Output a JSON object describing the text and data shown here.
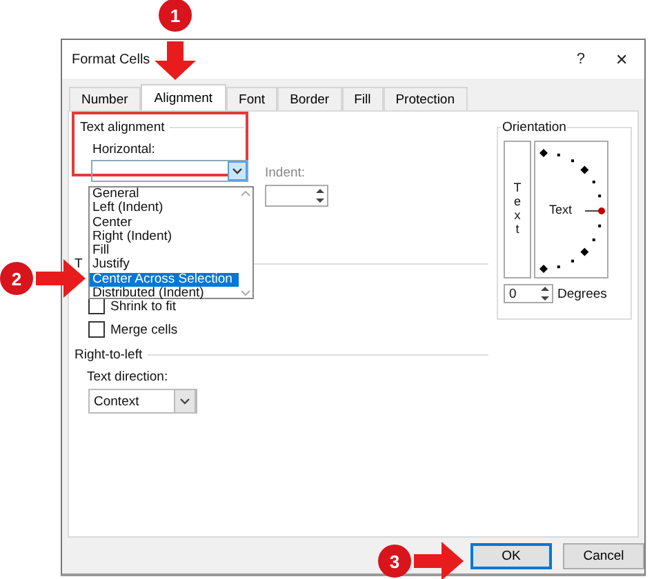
{
  "window": {
    "title": "Format Cells",
    "help": "?",
    "close": "✕"
  },
  "tabs": [
    {
      "label": "Number",
      "selected": false
    },
    {
      "label": "Alignment",
      "selected": true
    },
    {
      "label": "Font",
      "selected": false
    },
    {
      "label": "Border",
      "selected": false
    },
    {
      "label": "Fill",
      "selected": false
    },
    {
      "label": "Protection",
      "selected": false
    }
  ],
  "text_alignment": {
    "heading": "Text alignment",
    "horizontal_label": "Horizontal:",
    "indent_label": "Indent:",
    "options": [
      {
        "label": "General",
        "selected": false
      },
      {
        "label": "Left (Indent)",
        "selected": false
      },
      {
        "label": "Center",
        "selected": false
      },
      {
        "label": "Right (Indent)",
        "selected": false
      },
      {
        "label": "Fill",
        "selected": false
      },
      {
        "label": "Justify",
        "selected": false
      },
      {
        "label": "Center Across Selection",
        "selected": true
      },
      {
        "label": "Distributed (Indent)",
        "selected": false
      }
    ]
  },
  "text_control": {
    "heading": "T",
    "checkboxes": [
      {
        "label": "Shrink to fit",
        "checked": false
      },
      {
        "label": "Merge cells",
        "checked": false
      }
    ]
  },
  "right_to_left": {
    "heading": "Right-to-left",
    "direction_label": "Text direction:",
    "direction_value": "Context"
  },
  "orientation": {
    "heading": "Orientation",
    "vertical_text": "Text",
    "dial_text": "Text",
    "degrees_value": "0",
    "degrees_label": "Degrees"
  },
  "buttons": [
    {
      "label": "OK",
      "default": true
    },
    {
      "label": "Cancel",
      "default": false
    }
  ],
  "annotations": [
    {
      "number": "1",
      "kind": "down"
    },
    {
      "number": "2",
      "kind": "right"
    },
    {
      "number": "3",
      "kind": "right"
    }
  ]
}
